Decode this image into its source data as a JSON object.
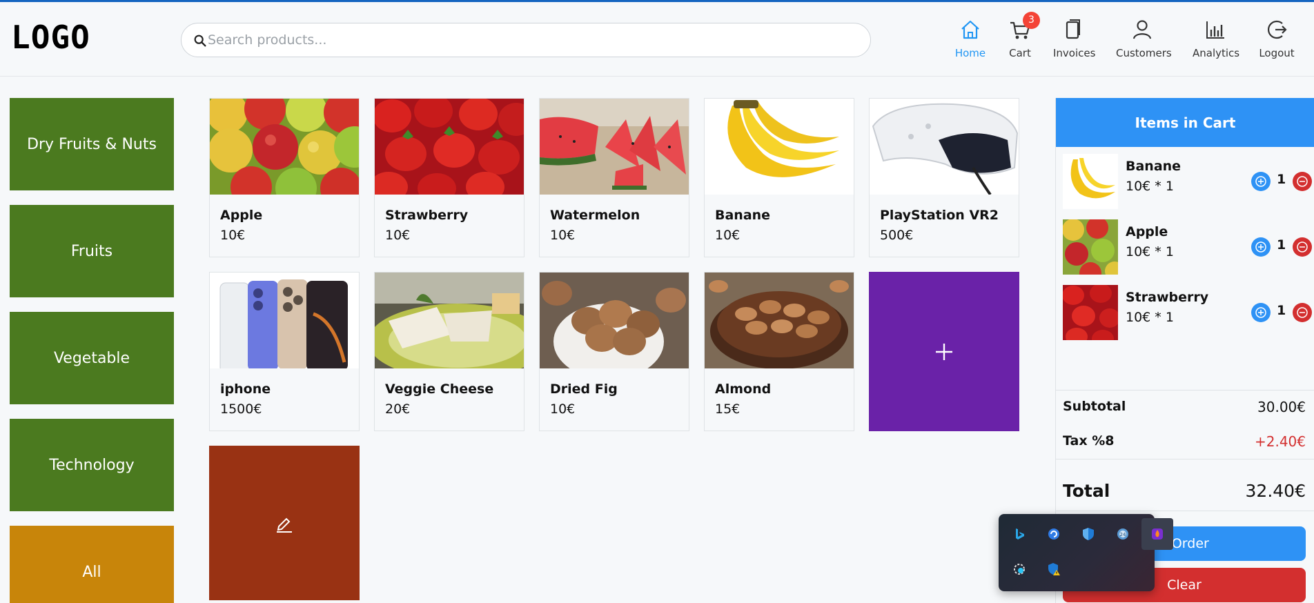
{
  "header": {
    "logo": "LOGO",
    "search_placeholder": "Search products...",
    "nav": [
      {
        "label": "Home",
        "icon": "home-icon",
        "active": true
      },
      {
        "label": "Cart",
        "icon": "cart-icon",
        "badge": "3"
      },
      {
        "label": "Invoices",
        "icon": "invoice-icon"
      },
      {
        "label": "Customers",
        "icon": "user-icon"
      },
      {
        "label": "Analytics",
        "icon": "bar-chart-icon"
      },
      {
        "label": "Logout",
        "icon": "logout-icon"
      }
    ]
  },
  "categories": [
    {
      "label": "Dry Fruits & Nuts",
      "color": "#4b7a1f"
    },
    {
      "label": "Fruits",
      "color": "#4b7a1f"
    },
    {
      "label": "Vegetable",
      "color": "#4b7a1f"
    },
    {
      "label": "Technology",
      "color": "#4b7a1f"
    },
    {
      "label": "All",
      "color": "#c8850a"
    }
  ],
  "products": [
    {
      "name": "Apple",
      "price": "10€"
    },
    {
      "name": "Strawberry",
      "price": "10€"
    },
    {
      "name": "Watermelon",
      "price": "10€"
    },
    {
      "name": "Banane",
      "price": "10€"
    },
    {
      "name": "PlayStation VR2",
      "price": "500€"
    },
    {
      "name": "iphone",
      "price": "1500€"
    },
    {
      "name": "Veggie Cheese",
      "price": "20€"
    },
    {
      "name": "Dried Fig",
      "price": "10€"
    },
    {
      "name": "Almond",
      "price": "15€"
    }
  ],
  "tiles": {
    "add_icon": "plus-icon",
    "add_color": "#6a22a8",
    "edit_icon": "edit-icon",
    "edit_color": "#993213"
  },
  "cart": {
    "title": "Items in Cart",
    "items": [
      {
        "name": "Banane",
        "detail": "10€ * 1",
        "qty": "1"
      },
      {
        "name": "Apple",
        "detail": "10€ * 1",
        "qty": "1"
      },
      {
        "name": "Strawberry",
        "detail": "10€ * 1",
        "qty": "1"
      }
    ],
    "subtotal_label": "Subtotal",
    "subtotal_value": "30.00€",
    "tax_label": "Tax %8",
    "tax_value": "+2.40€",
    "total_label": "Total",
    "total_value": "32.40€",
    "order_button": "e Order",
    "clear_button": "Clear",
    "accent_color": "#2e92f5",
    "danger_color": "#d32f2f"
  },
  "tray": {
    "icons": [
      "bing-icon",
      "sync-app-icon",
      "defender-icon",
      "clock-app-icon",
      "flame-app-icon",
      "snip-app-icon",
      "security-warning-icon"
    ]
  }
}
